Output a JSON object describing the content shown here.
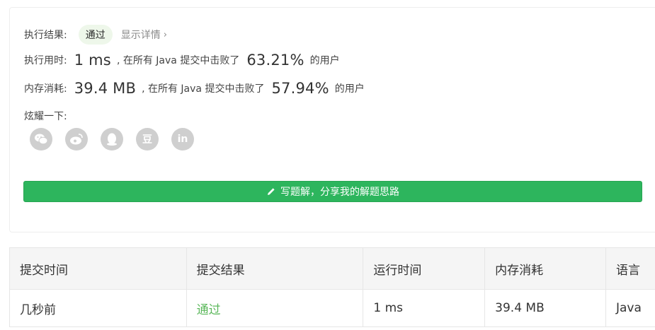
{
  "result": {
    "label": "执行结果:",
    "status": "通过",
    "details_link": "显示详情",
    "chevron": "›"
  },
  "runtime": {
    "label": "执行用时:",
    "value": "1 ms",
    "mid_text": ", 在所有 Java 提交中击败了",
    "percent": "63.21%",
    "suffix": "的用户"
  },
  "memory": {
    "label": "内存消耗:",
    "value": "39.4 MB",
    "mid_text": ", 在所有 Java 提交中击败了",
    "percent": "57.94%",
    "suffix": "的用户"
  },
  "share": {
    "label": "炫耀一下:",
    "icons": [
      "wechat-icon",
      "weibo-icon",
      "qq-icon",
      "douban-icon",
      "linkedin-icon"
    ],
    "douban_glyph": "豆",
    "linkedin_glyph": "in"
  },
  "write_button": {
    "label": "写题解，分享我的解题思路",
    "color": "#2db55d"
  },
  "submissions": {
    "headers": [
      "提交时间",
      "提交结果",
      "运行时间",
      "内存消耗",
      "语言"
    ],
    "rows": [
      {
        "time": "几秒前",
        "result": "通过",
        "runtime": "1 ms",
        "memory": "39.4 MB",
        "language": "Java"
      }
    ]
  }
}
